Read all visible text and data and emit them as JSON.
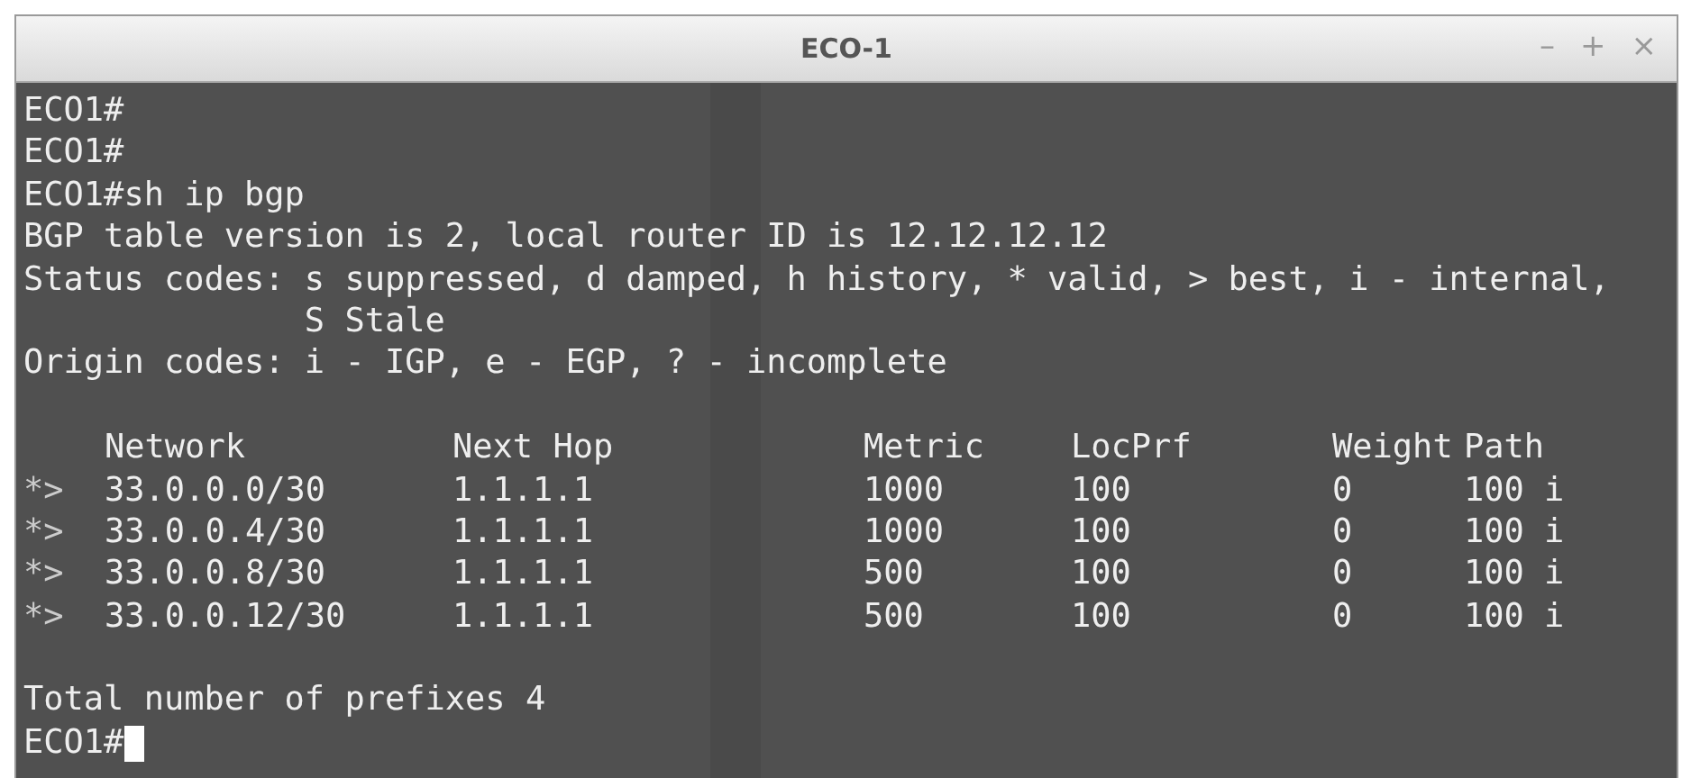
{
  "window": {
    "title": "ECO-1",
    "controls": [
      "–",
      "+",
      "×"
    ]
  },
  "terminal": {
    "lines": [
      "ECO1#",
      "ECO1#",
      "ECO1#sh ip bgp",
      "BGP table version is 2, local router ID is 12.12.12.12",
      "Status codes: s suppressed, d damped, h history, * valid, > best, i - internal,",
      "              S Stale",
      "Origin codes: i - IGP, e - EGP, ? - incomplete"
    ],
    "table": {
      "columns": [
        "Network",
        "Next Hop",
        "Metric",
        "LocPrf",
        "Weight",
        "Path"
      ],
      "rows": [
        {
          "status": "*>",
          "network": "33.0.0.0/30",
          "next_hop": "1.1.1.1",
          "metric": "1000",
          "locprf": "100",
          "weight": "0",
          "path": "100 i"
        },
        {
          "status": "*>",
          "network": "33.0.0.4/30",
          "next_hop": "1.1.1.1",
          "metric": "1000",
          "locprf": "100",
          "weight": "0",
          "path": "100 i"
        },
        {
          "status": "*>",
          "network": "33.0.0.8/30",
          "next_hop": "1.1.1.1",
          "metric": "500",
          "locprf": "100",
          "weight": "0",
          "path": "100 i"
        },
        {
          "status": "*>",
          "network": "33.0.0.12/30",
          "next_hop": "1.1.1.1",
          "metric": "500",
          "locprf": "100",
          "weight": "0",
          "path": "100 i"
        }
      ]
    },
    "summary": "Total number of prefixes 4",
    "prompt": "ECO1#"
  }
}
